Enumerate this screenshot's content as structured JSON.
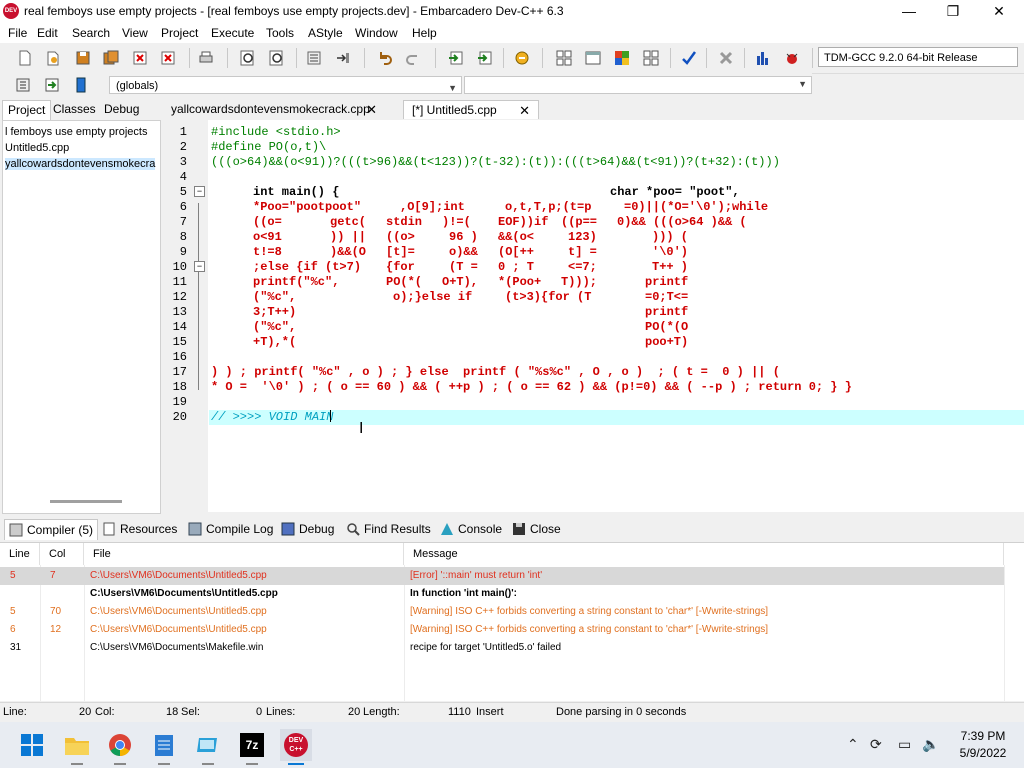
{
  "window": {
    "title": "real femboys use empty projects - [real femboys use empty projects.dev] - Embarcadero Dev-C++ 6.3",
    "icon_label": "DEV",
    "minimize": "—",
    "maximize": "❐",
    "close": "✕"
  },
  "menu": [
    "File",
    "Edit",
    "Search",
    "View",
    "Project",
    "Execute",
    "Tools",
    "AStyle",
    "Window",
    "Help"
  ],
  "toolbar": {
    "compiler": "TDM-GCC 9.2.0 64-bit Release",
    "scope": "(globals)",
    "function": ""
  },
  "left_tabs": [
    "Project",
    "Classes",
    "Debug"
  ],
  "project_tree": [
    "l femboys use empty projects",
    "Untitled5.cpp",
    "yallcowardsdontevensmokecra"
  ],
  "editor_tabs": [
    {
      "label": "yallcowardsdontevensmokecrack.cpp",
      "close": "✕"
    },
    {
      "label": "[*] Untitled5.cpp",
      "close": "✕"
    }
  ],
  "line_numbers": [
    "1",
    "2",
    "3",
    "4",
    "5",
    "6",
    "7",
    "8",
    "9",
    "10",
    "11",
    "12",
    "13",
    "14",
    "15",
    "16",
    "17",
    "18",
    "19",
    "20"
  ],
  "code": {
    "l1": "#include <stdio.h>",
    "l2": "#define PO(o,t)\\",
    "l3": "(((o>64)&&(o<91))?(((t>96)&&(t<123))?(t-32):(t)):(((t>64)&&(t<91))?(t+32):(t)))",
    "l5_a": "int main() {",
    "l5_b": "char *poo= \"poot\",",
    "l6_a": "*Poo=\"pootpoot\"",
    "l6_b": ",O[9];int",
    "l6_c": "o,t,T,p;(t=p",
    "l6_d": "=0)||(*O='\\0');while",
    "l7_a": "((o=",
    "l7_b": "getc(",
    "l7_c": "stdin",
    "l7_d": ")!=(",
    "l7_e": "EOF))if",
    "l7_f": "((p==",
    "l7_g": "0)&& (((o>64 )&& (",
    "l8_a": "o<91",
    "l8_b": ")) ||",
    "l8_c": "((o>",
    "l8_d": "96 )",
    "l8_e": "&&(o<",
    "l8_f": "123)",
    "l8_g": "))) (",
    "l9_a": "t!=8",
    "l9_b": ")&&(O",
    "l9_c": "[t]=",
    "l9_d": "o)&&",
    "l9_e": "(O[++",
    "l9_f": "t] =",
    "l9_g": "'\\0')",
    "l10_a": ";else {if (t>7)",
    "l10_b": "{for",
    "l10_c": "(T =",
    "l10_d": "0 ; T",
    "l10_e": "<=7;",
    "l10_f": "T++ )",
    "l11_a": "printf(\"%c\",",
    "l11_b": "PO(*(",
    "l11_c": "O+T),",
    "l11_d": "*(Poo+",
    "l11_e": "T)));",
    "l11_f": "printf",
    "l12_a": "(\"%c\",",
    "l12_b": "o);}else if",
    "l12_c": "(t>3){for (T",
    "l12_d": "=0;T<=",
    "l13_a": "3;T++)",
    "l13_b": "printf",
    "l14_a": "(\"%c\",",
    "l14_b": "PO(*(O",
    "l15_a": "+T),*(",
    "l15_b": "poo+T)",
    "l17": ") ) ; printf( \"%c\" , o ) ; } else  printf ( \"%s%c\" , O , o )  ; ( t =  0 ) || (",
    "l18": "* O =  '\\0' ) ; ( o == 60 ) && ( ++p ) ; ( o == 62 ) && (p!=0) && ( --p ) ; return 0; } }",
    "l20": "// >>>> VOID MAIN"
  },
  "bottom_tabs": [
    "Compiler (5)",
    "Resources",
    "Compile Log",
    "Debug",
    "Find Results",
    "Console",
    "Close"
  ],
  "messages": {
    "headers": [
      "Line",
      "Col",
      "File",
      "Message"
    ],
    "rows": [
      {
        "line": "5",
        "col": "7",
        "file": "C:\\Users\\VM6\\Documents\\Untitled5.cpp",
        "msg": "[Error] '::main' must return 'int'"
      },
      {
        "line": "",
        "col": "",
        "file": "C:\\Users\\VM6\\Documents\\Untitled5.cpp",
        "msg": "In function 'int main()':"
      },
      {
        "line": "5",
        "col": "70",
        "file": "C:\\Users\\VM6\\Documents\\Untitled5.cpp",
        "msg": "[Warning] ISO C++ forbids converting a string constant to 'char*' [-Wwrite-strings]"
      },
      {
        "line": "6",
        "col": "12",
        "file": "C:\\Users\\VM6\\Documents\\Untitled5.cpp",
        "msg": "[Warning] ISO C++ forbids converting a string constant to 'char*' [-Wwrite-strings]"
      },
      {
        "line": "31",
        "col": "",
        "file": "C:\\Users\\VM6\\Documents\\Makefile.win",
        "msg": "recipe for target 'Untitled5.o' failed"
      }
    ]
  },
  "status": {
    "line_label": "Line:",
    "line_val": "20",
    "col_label": "Col:",
    "col_val": "18",
    "sel_label": "Sel:",
    "sel_val": "0",
    "lines_label": "Lines:",
    "lines_val": "20",
    "length_label": "Length:",
    "length_val": "1110",
    "mode": "Insert",
    "parse": "Done parsing in 0 seconds"
  },
  "taskbar": {
    "dev_label": "DEV C++",
    "zip_label": "7z",
    "time": "7:39 PM",
    "date": "5/9/2022"
  },
  "colors": {
    "accent_red": "#d00000",
    "preprocessor_green": "#008000",
    "current_line": "#ccffff",
    "error": "#e0301e",
    "warning": "#e07020"
  }
}
